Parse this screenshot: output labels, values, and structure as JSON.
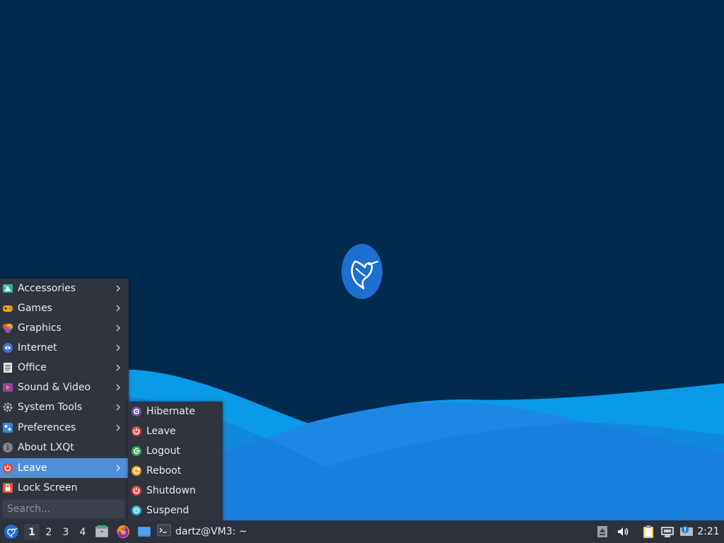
{
  "desktop": {
    "background_color": "#012a4f",
    "logo_icon": "lubuntu-hummingbird-icon"
  },
  "start_menu": {
    "items": [
      {
        "label": "Accessories",
        "icon": "accessories-icon",
        "has_submenu": true
      },
      {
        "label": "Games",
        "icon": "games-icon",
        "has_submenu": true
      },
      {
        "label": "Graphics",
        "icon": "graphics-icon",
        "has_submenu": true
      },
      {
        "label": "Internet",
        "icon": "internet-icon",
        "has_submenu": true
      },
      {
        "label": "Office",
        "icon": "office-icon",
        "has_submenu": true
      },
      {
        "label": "Sound & Video",
        "icon": "sound-video-icon",
        "has_submenu": true
      },
      {
        "label": "System Tools",
        "icon": "system-tools-icon",
        "has_submenu": true
      },
      {
        "label": "Preferences",
        "icon": "preferences-icon",
        "has_submenu": true
      },
      {
        "label": "About LXQt",
        "icon": "info-icon",
        "has_submenu": false
      },
      {
        "label": "Leave",
        "icon": "power-icon",
        "has_submenu": true,
        "active": true
      },
      {
        "label": "Lock Screen",
        "icon": "lock-icon",
        "has_submenu": false
      }
    ],
    "search": {
      "placeholder": "Search...",
      "value": ""
    },
    "active_color": "#4f8fd9"
  },
  "leave_submenu": {
    "items": [
      {
        "label": "Hibernate",
        "icon": "hibernate-icon"
      },
      {
        "label": "Leave",
        "icon": "power-icon"
      },
      {
        "label": "Logout",
        "icon": "logout-icon"
      },
      {
        "label": "Reboot",
        "icon": "reboot-icon"
      },
      {
        "label": "Shutdown",
        "icon": "shutdown-icon"
      },
      {
        "label": "Suspend",
        "icon": "suspend-icon"
      }
    ]
  },
  "taskbar": {
    "start_button_icon": "lubuntu-menu-icon",
    "desktops": [
      "1",
      "2",
      "3",
      "4"
    ],
    "current_desktop": "1",
    "quicklaunch": [
      {
        "name": "file-manager-icon"
      },
      {
        "name": "firefox-icon"
      },
      {
        "name": "show-desktop-icon"
      }
    ],
    "task": {
      "label": "dartz@VM3: ~",
      "icon": "terminal-icon"
    },
    "tray": [
      {
        "name": "eject-icon"
      },
      {
        "name": "volume-icon"
      },
      {
        "name": "clipboard-icon"
      },
      {
        "name": "network-icon"
      },
      {
        "name": "update-notifier-icon"
      }
    ],
    "clock": "2:21"
  }
}
